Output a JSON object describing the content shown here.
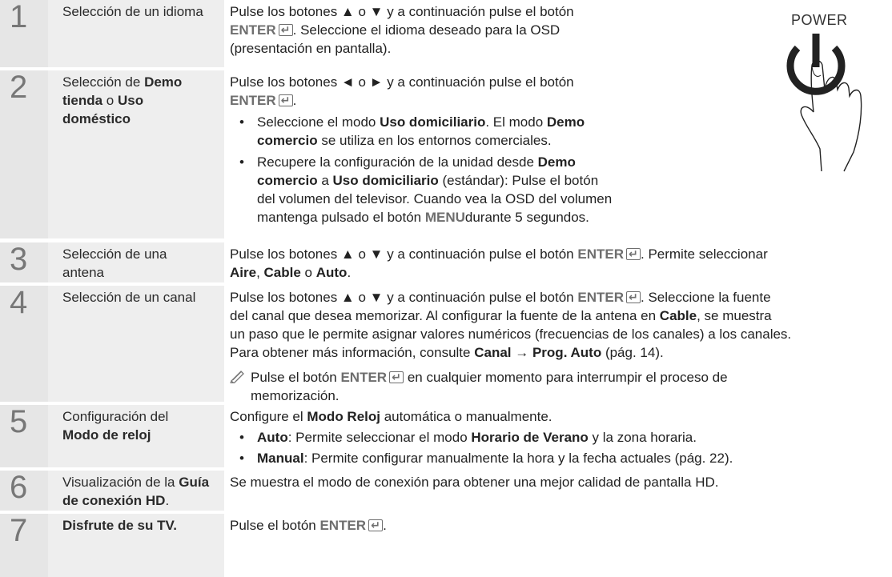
{
  "steps": [
    {
      "number": "1",
      "title": "Selección de un idioma",
      "desc_1": "Pulse los botones ▲ o ▼ y a continuación pulse el botón",
      "enter": "ENTER",
      "desc_2": ". Seleccione el idioma deseado para la OSD",
      "desc_3": "(presentación en pantalla)."
    },
    {
      "number": "2",
      "title_1": "Selección de ",
      "title_b1": "Demo",
      "title_b2": "tienda",
      "title_2": " o ",
      "title_b3": "Uso",
      "title_b4": "doméstico",
      "desc_1": "Pulse los botones ◄ o ► y a continuación pulse el botón",
      "enter": "ENTER",
      "desc_2": ".",
      "bullet_1_a": "Seleccione el modo ",
      "bullet_1_b": "Uso domiciliario",
      "bullet_1_c": ". El modo ",
      "bullet_1_d": "Demo",
      "bullet_1_e": "comercio",
      "bullet_1_f": " se utiliza en los entornos comerciales.",
      "bullet_2_a": "Recupere la configuración de la unidad desde ",
      "bullet_2_b": "Demo",
      "bullet_2_c": "comercio",
      "bullet_2_d": " a ",
      "bullet_2_e": "Uso domiciliario",
      "bullet_2_f": " (estándar): Pulse el botón",
      "bullet_2_g": "del volumen del televisor. Cuando vea la OSD del volumen",
      "bullet_2_h": "mantenga pulsado el botón ",
      "bullet_2_i": "MENU",
      "bullet_2_j": "durante 5 segundos."
    },
    {
      "number": "3",
      "title_1": "Selección de una",
      "title_2": "antena",
      "desc_1": "Pulse los botones ▲ o ▼ y a continuación pulse el botón ",
      "enter": "ENTER",
      "desc_2": ". Permite seleccionar",
      "opt_1": "Aire",
      "sep_1": ", ",
      "opt_2": "Cable",
      "sep_2": " o ",
      "opt_3": "Auto",
      "end": "."
    },
    {
      "number": "4",
      "title": "Selección de un canal",
      "desc_1": "Pulse los botones ▲ o ▼ y a continuación pulse el botón ",
      "enter": "ENTER",
      "desc_2": ". Seleccione la fuente",
      "desc_3": "del canal que desea memorizar. Al configurar la fuente de la antena en ",
      "desc_3b": "Cable",
      "desc_3c": ", se muestra",
      "desc_4": "un paso que le permite asignar valores numéricos (frecuencias de los canales) a los canales.",
      "desc_5": "Para obtener más información, consulte ",
      "desc_5b": "Canal",
      "desc_5c": " → ",
      "desc_5d": "Prog. Auto",
      "desc_5e": " (pág. 14).",
      "note_1": "Pulse el botón ",
      "note_enter": "ENTER",
      "note_2": " en cualquier momento para interrumpir el proceso de",
      "note_3": "memorización."
    },
    {
      "number": "5",
      "title_1": "Configuración del",
      "title_2": "Modo de reloj",
      "desc_1": "Configure el ",
      "desc_1b": "Modo Reloj",
      "desc_1c": " automática o manualmente.",
      "b1_a": "Auto",
      "b1_b": ": Permite seleccionar el modo ",
      "b1_c": "Horario de Verano",
      "b1_d": " y la zona horaria.",
      "b2_a": "Manual",
      "b2_b": ": Permite configurar manualmente la hora y la fecha actuales (pág. 22)."
    },
    {
      "number": "6",
      "title_1": "Visualización de la ",
      "title_b1": "Guía",
      "title_b2": "de conexión HD",
      "title_2": ".",
      "desc": "Se muestra el modo de conexión para obtener una mejor calidad de pantalla HD."
    },
    {
      "number": "7",
      "title": "Disfrute de su TV.",
      "desc_1": "Pulse el botón ",
      "enter": "ENTER",
      "desc_2": "."
    }
  ],
  "power": {
    "label": "POWER"
  }
}
